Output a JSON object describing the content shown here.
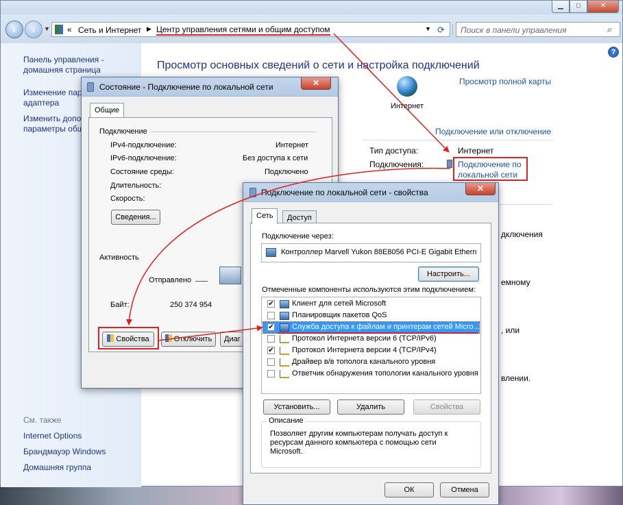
{
  "explorer": {
    "breadcrumb": [
      "Сеть и Интернет",
      "Центр управления сетями и общим доступом"
    ],
    "search_placeholder": "Поиск в панели управления",
    "sidebar": {
      "home": "Панель управления - домашняя страница",
      "change_adapter": "Изменение параметров адаптера",
      "change_sharing": "Изменить дополнительные параметры общего доступа",
      "see_also": "См. также",
      "links": [
        "Internet Options",
        "Брандмауэр Windows",
        "Домашняя группа"
      ]
    },
    "main": {
      "title": "Просмотр основных сведений о сети и настройка подключений",
      "full_map": "Просмотр полной карты",
      "internet_label": "Интернет",
      "connect_disconnect": "Подключение или отключение",
      "access_type_label": "Тип доступа:",
      "access_type_value": "Интернет",
      "connections_label": "Подключения:",
      "connection_link": "Подключение по локальной сети",
      "partial_1": "дключения",
      "partial_2": "емному",
      "partial_3": ", или",
      "partial_4": "влении."
    }
  },
  "status_dialog": {
    "title": "Состояние - Подключение по локальной сети",
    "tab": "Общие",
    "group_connection": "Подключение",
    "rows": [
      {
        "label": "IPv4-подключение:",
        "value": "Интернет"
      },
      {
        "label": "IPv6-подключение:",
        "value": "Без доступа к сети"
      },
      {
        "label": "Состояние среды:",
        "value": "Подключено"
      },
      {
        "label": "Длительность:",
        "value": ""
      },
      {
        "label": "Скорость:",
        "value": ""
      }
    ],
    "details_button": "Сведения...",
    "group_activity": "Активность",
    "sent_label": "Отправлено",
    "bytes_label": "Байт:",
    "bytes_value": "250 374 954",
    "properties_button": "Свойства",
    "disable_button": "Отключить",
    "diagnose_button": "Диаг"
  },
  "props_dialog": {
    "title": "Подключение по локальной сети - свойства",
    "tabs": [
      "Сеть",
      "Доступ"
    ],
    "connect_via_label": "Подключение через:",
    "adapter_name": "Контроллер Marvell Yukon 88E8056 PCI-E Gigabit Ethern",
    "configure_button": "Настроить...",
    "components_label": "Отмеченные компоненты используются этим подключением:",
    "components": [
      {
        "label": "Клиент для сетей Microsoft",
        "checked": true,
        "icon": "network-client-icon"
      },
      {
        "label": "Планировщик пакетов QoS",
        "checked": false,
        "icon": "network-service-icon"
      },
      {
        "label": "Служба доступа к файлам и принтерам сетей Micro...",
        "checked": true,
        "icon": "network-service-icon"
      },
      {
        "label": "Протокол Интернета версии 6 (TCP/IPv6)",
        "checked": false,
        "icon": "protocol-icon"
      },
      {
        "label": "Протокол Интернета версии 4 (TCP/IPv4)",
        "checked": true,
        "icon": "protocol-icon"
      },
      {
        "label": "Драйвер в/в тополога канального уровня",
        "checked": false,
        "icon": "protocol-icon"
      },
      {
        "label": "Ответчик обнаружения топологии канального уровня",
        "checked": false,
        "icon": "protocol-icon"
      }
    ],
    "selected_index": 2,
    "install_button": "Установить...",
    "remove_button": "Удалить",
    "properties_button": "Свойства",
    "description_label": "Описание",
    "description_text": "Позволяет другим компьютерам получать доступ к ресурсам данного компьютера с помощью сети Microsoft.",
    "ok_button": "ОК",
    "cancel_button": "Отмена"
  },
  "colors": {
    "link": "#1a55a8",
    "annotation_red": "#e02020",
    "selection": "#3399ff"
  }
}
